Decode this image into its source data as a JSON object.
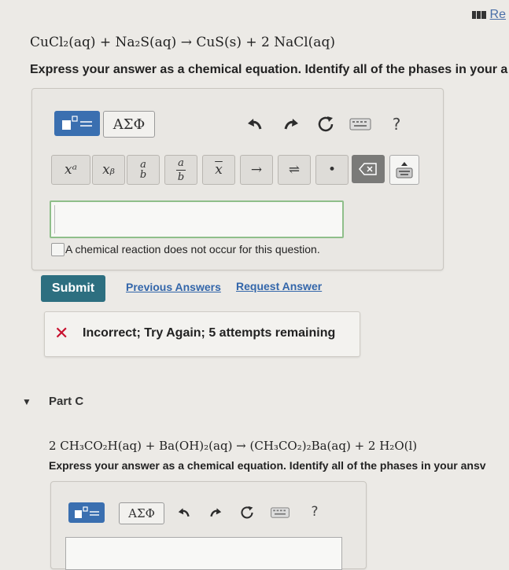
{
  "header": {
    "link_label": "Re"
  },
  "partB": {
    "equation": "CuCl₂(aq) + Na₂S(aq) → CuS(s) + 2 NaCl(aq)",
    "instruction": "Express your answer as a chemical equation. Identify all of the phases in your a",
    "toolbar": {
      "greek_label": "ΑΣΦ",
      "help_label": "?",
      "undo_icon": "undo-icon",
      "redo_icon": "redo-icon",
      "reset_icon": "reset-icon",
      "keyboard_icon": "keyboard-icon"
    },
    "symbols": {
      "superscript": "xᵃ",
      "subscript": "xᵦ",
      "frac_num": "a",
      "frac_den": "b",
      "overline": "x",
      "arrow": "→",
      "equilibrium": "⇌",
      "dot": "•",
      "delete_icon": "delete-icon",
      "keyboard_icon": "keyboard-toggle-icon"
    },
    "no_reaction_label": "A chemical reaction does not occur for this question.",
    "submit_label": "Submit",
    "previous_answers_label": "Previous Answers",
    "request_answer_label": "Request Answer",
    "feedback": "Incorrect; Try Again; 5 attempts remaining",
    "feedback_mark": "✕"
  },
  "partC": {
    "label": "Part C",
    "toggle": "▼",
    "equation": "2 CH₃CO₂H(aq) + Ba(OH)₂(aq) → (CH₃CO₂)₂Ba(aq) + 2 H₂O(l)",
    "instruction": "Express your answer as a chemical equation. Identify all of the phases in your ansv",
    "toolbar": {
      "greek_label": "ΑΣΦ",
      "help_label": "?"
    }
  }
}
